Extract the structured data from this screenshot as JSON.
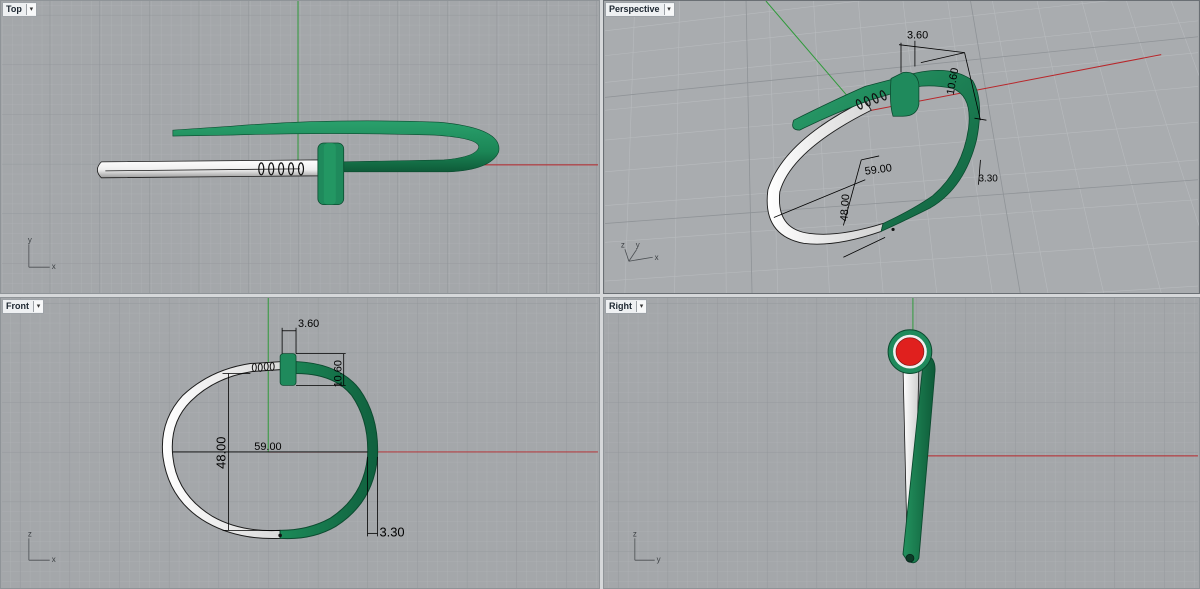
{
  "app": "Rhinoceros viewport layout",
  "colors": {
    "viewport_bg": "#a4a7aa",
    "grid_minor": "#b3b6b9",
    "grid_major": "#8c9094",
    "x_axis": "#b8262a",
    "y_axis": "#2f9a3a",
    "band_green": "#1f8a5c",
    "band_green_dark": "#0f5a3a",
    "band_white": "#f4f4f4",
    "head_face_red": "#e0201e",
    "dimension": "#000000"
  },
  "viewports": [
    {
      "id": "top",
      "title": "Top",
      "active": false,
      "axis_labels": {
        "vertical": "y",
        "horizontal": "x"
      },
      "dimensions": []
    },
    {
      "id": "perspective",
      "title": "Perspective",
      "active": true,
      "axis_labels": {
        "vertical": "y",
        "horizontal": "x",
        "depth": "z"
      },
      "dimensions": [
        {
          "name": "head-width",
          "value": "3.60"
        },
        {
          "name": "head-height",
          "value": "10.60"
        },
        {
          "name": "inner-width",
          "value": "59.00"
        },
        {
          "name": "inner-height",
          "value": "48.00"
        },
        {
          "name": "band-thickness",
          "value": "3.30"
        }
      ]
    },
    {
      "id": "front",
      "title": "Front",
      "active": false,
      "axis_labels": {
        "vertical": "z",
        "horizontal": "x"
      },
      "dimensions": [
        {
          "name": "head-width",
          "value": "3.60"
        },
        {
          "name": "head-height",
          "value": "10.60"
        },
        {
          "name": "inner-width",
          "value": "59.00"
        },
        {
          "name": "inner-height",
          "value": "48.00"
        },
        {
          "name": "band-thickness",
          "value": "3.30"
        }
      ]
    },
    {
      "id": "right",
      "title": "Right",
      "active": false,
      "axis_labels": {
        "vertical": "z",
        "horizontal": "y"
      },
      "dimensions": []
    }
  ],
  "menu_icon": "chevron-down-icon"
}
